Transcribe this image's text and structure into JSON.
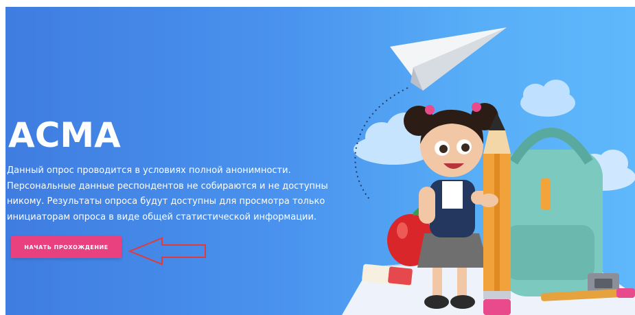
{
  "hero": {
    "title": "ACMA",
    "description_lines": [
      "Данный опрос проводится в условиях полной анонимности.",
      "Персональные данные респондентов не собираются и не доступны",
      "никому. Результаты опроса будут доступны для просмотра только",
      "инициаторам опроса в виде общей статистической информации."
    ],
    "cta_label": "НАЧАТЬ ПРОХОЖДЕНИЕ"
  },
  "colors": {
    "gradient_start": "#3f7de0",
    "gradient_end": "#5fb8fb",
    "cta_background": "#e9407f",
    "arrow_stroke": "#e23a3a"
  },
  "icons": [
    "red-arrow-annotation-icon",
    "paper-plane-icon",
    "cloud-icon",
    "backpack-icon",
    "girl-with-pencil-illustration",
    "apple-icon",
    "eraser-icon",
    "sharpener-icon",
    "book-icon"
  ]
}
